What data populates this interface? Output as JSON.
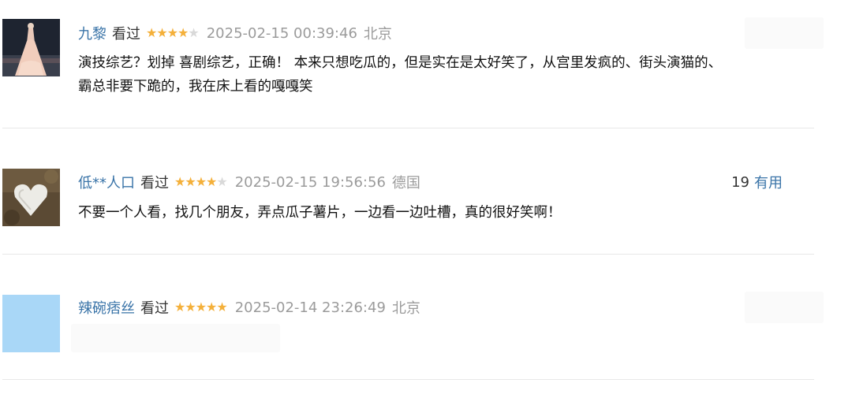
{
  "comments": [
    {
      "user": "九黎",
      "action": "看过",
      "rating": 4,
      "time": "2025-02-15 00:39:46",
      "location": "北京",
      "lines": [
        "演技综艺？划掉 喜剧综艺，正确！ 本来只想吃瓜的，但是实在是太好笑了，从宫里发疯的、街头演猫的、",
        "霸总非要下跪的，我在床上看的嘎嘎笑"
      ]
    },
    {
      "user": "低**人口",
      "action": "看过",
      "rating": 4,
      "time": "2025-02-15 19:56:56",
      "location": "德国",
      "votes": "19",
      "vote_label": "有用",
      "lines": [
        "不要一个人看，找几个朋友，弄点瓜子薯片，一边看一边吐槽，真的很好笑啊！"
      ]
    },
    {
      "user": "辣碗痞丝",
      "action": "看过",
      "rating": 5,
      "time": "2025-02-14 23:26:49",
      "location": "北京"
    }
  ],
  "colors": {
    "username": "#3a74a8",
    "star_on": "#f4b03a",
    "star_off": "#d9d9d9",
    "meta_gray": "#9b9b9b"
  }
}
